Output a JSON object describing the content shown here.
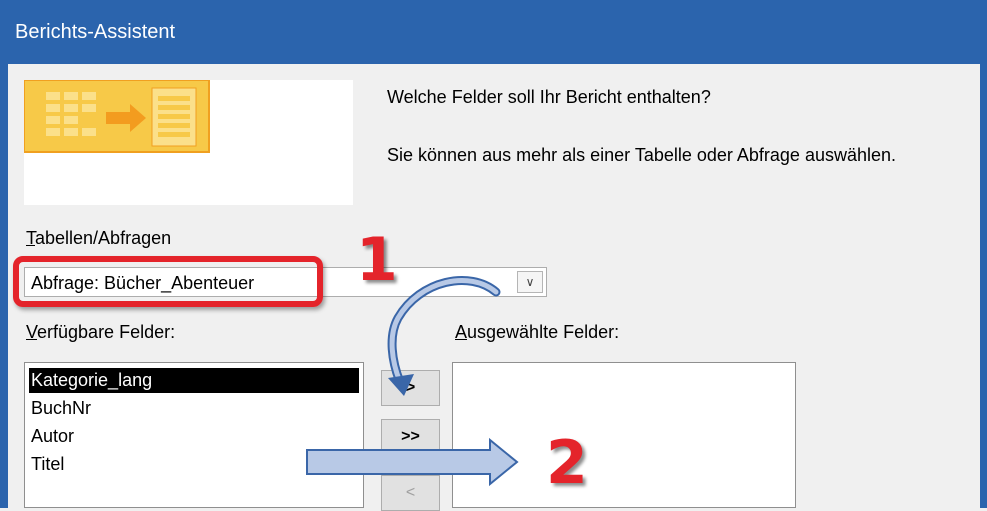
{
  "window": {
    "title": "Berichts-Assistent"
  },
  "wizard_image": {
    "icon": "report-wizard-icon"
  },
  "prompts": {
    "question": "Welche Felder soll Ihr Bericht enthalten?",
    "hint": "Sie können aus mehr als einer Tabelle oder Abfrage auswählen."
  },
  "tables_queries": {
    "label_mnemonic": "T",
    "label_rest": "abellen/Abfragen",
    "selected_value": "Abfrage: Bücher_Abenteuer"
  },
  "available_fields": {
    "label_mnemonic": "V",
    "label_rest": "erfügbare Felder:",
    "items": [
      "Kategorie_lang",
      "BuchNr",
      "Autor",
      "Titel"
    ],
    "selected_index": 0
  },
  "selected_fields": {
    "label_mnemonic": "A",
    "label_rest": "usgewählte Felder:",
    "items": []
  },
  "move_buttons": {
    "add_one": ">",
    "add_all": ">>",
    "remove_one": "<"
  },
  "annotations": {
    "step1": "1",
    "step2": "2",
    "color": "#e4242b"
  },
  "colors": {
    "titlebar": "#2b64ad",
    "annotation_red": "#e4242b",
    "arrow_fill": "#b8c9e6",
    "arrow_stroke": "#3a66a8"
  }
}
